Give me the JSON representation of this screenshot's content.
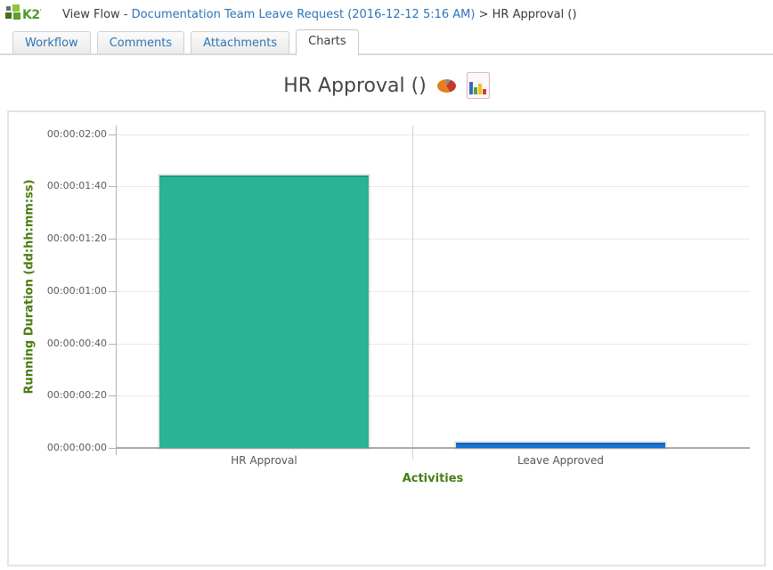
{
  "header": {
    "logo_text": "K2",
    "title_prefix": "View Flow - ",
    "link_text": "Documentation Team Leave Request (2016-12-12 5:16 AM)",
    "title_suffix": " > HR Approval ()"
  },
  "tabs": [
    {
      "label": "Workflow",
      "active": false
    },
    {
      "label": "Comments",
      "active": false
    },
    {
      "label": "Attachments",
      "active": false
    },
    {
      "label": "Charts",
      "active": true
    }
  ],
  "chart_header": {
    "title": "HR Approval ()",
    "pie_icon": "pie-chart-icon",
    "bar_icon": "bar-chart-icon"
  },
  "chart_data": {
    "type": "bar",
    "title": "HR Approval ()",
    "xlabel": "Activities",
    "ylabel": "Running Duration (dd:hh:mm:ss)",
    "categories": [
      "HR Approval",
      "Leave Approved"
    ],
    "values_seconds": [
      104,
      2
    ],
    "bar_colors": [
      "#2ab394",
      "#1873d2"
    ],
    "bar_top_colors": [
      "#1e9b7e",
      "#1464bd"
    ],
    "ylim_seconds": [
      0,
      120
    ],
    "yticks": [
      "00:00:02:00",
      "00:00:01:40",
      "00:00:01:20",
      "00:00:01:00",
      "00:00:00:40",
      "00:00:00:20",
      "00:00:00:00"
    ],
    "grid": true,
    "legend": false
  },
  "colors": {
    "link_blue": "#2d74b9",
    "tab_text_blue": "#2c74b3",
    "axis_title_green": "#4a7c11",
    "k2_green_light": "#8dc63f",
    "k2_green_dark": "#47711c",
    "bar_green": "#2ab394",
    "bar_blue": "#1873d2"
  }
}
